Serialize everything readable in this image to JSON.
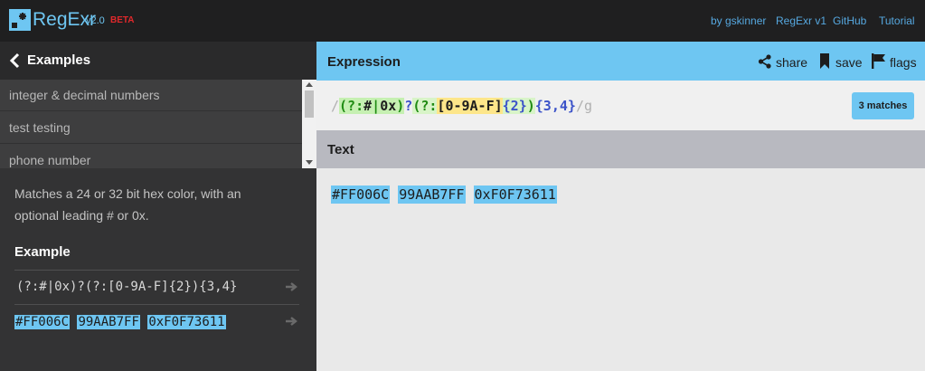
{
  "app": {
    "name": "RegExr",
    "version": "v2.0",
    "badge": "BETA",
    "accent_color": "#6ec6f2",
    "beta_color": "#e0282b"
  },
  "top_links": {
    "by": "by gskinner",
    "v1": "RegExr v1",
    "github": "GitHub",
    "tutorial": "Tutorial"
  },
  "sidebar": {
    "title": "Examples",
    "items": [
      {
        "label": "integer & decimal numbers"
      },
      {
        "label": "test testing"
      },
      {
        "label": "phone number"
      }
    ],
    "description": "Matches a 24 or 32 bit hex color, with an optional leading # or 0x.",
    "example_label": "Example",
    "example_expression": "(?:#|0x)?(?:[0-9A-F]{2}){3,4}",
    "example_text_matches": [
      "#FF006C",
      "99AAB7FF",
      "0xF0F73611"
    ]
  },
  "expression": {
    "title": "Expression",
    "share_label": "share",
    "save_label": "save",
    "flags_label": "flags",
    "matches_badge": "3 matches",
    "tokens": {
      "open_slash": "/",
      "group1_open": "(?:",
      "hash": "#",
      "pipe": "|",
      "ox": "0x",
      "group1_close": ")",
      "q": "?",
      "group2_open": "(?:",
      "set_open": "[",
      "range1": "0-9",
      "range2": "A-F",
      "set_close": "]",
      "quant2": "{2}",
      "group2_close": ")",
      "quant34": "{3,4}",
      "close_slash": "/",
      "flag": "g"
    }
  },
  "text": {
    "title": "Text",
    "matches": [
      "#FF006C",
      "99AAB7FF",
      "0xF0F73611"
    ]
  }
}
